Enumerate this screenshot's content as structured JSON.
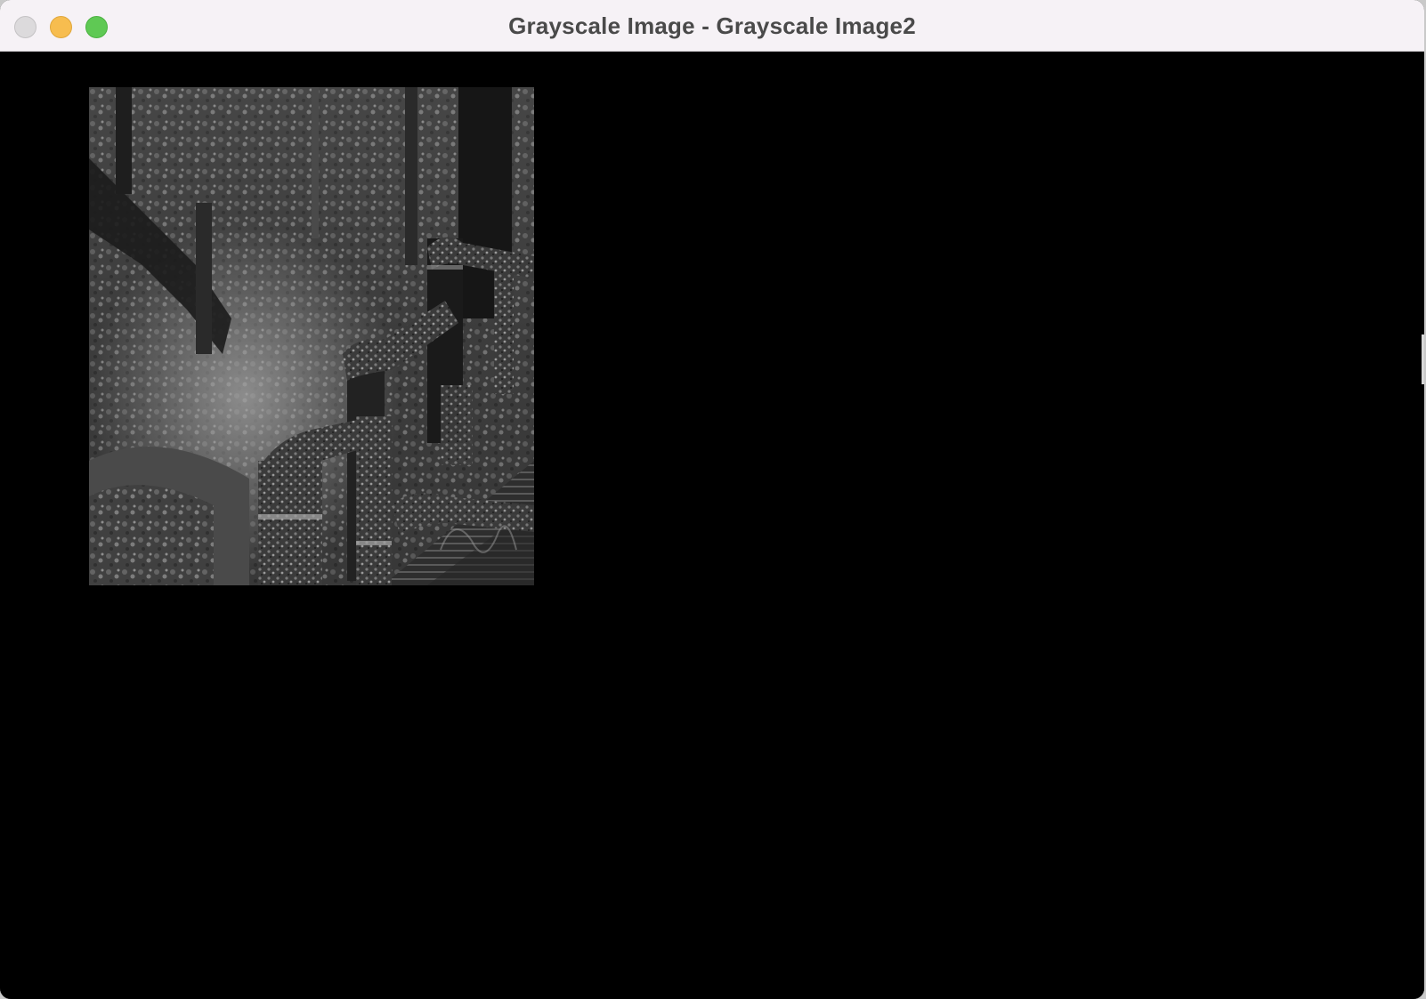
{
  "window": {
    "title": "Grayscale Image - Grayscale Image2"
  },
  "icons": {
    "close": "close-icon",
    "minimize": "minimize-icon",
    "zoom": "zoom-icon"
  },
  "colors": {
    "titlebar_bg": "#f6f2f6",
    "content_bg": "#000000",
    "close_button": "#dcdadc",
    "minimize_button": "#f7bd4f",
    "zoom_button": "#5fc954"
  }
}
